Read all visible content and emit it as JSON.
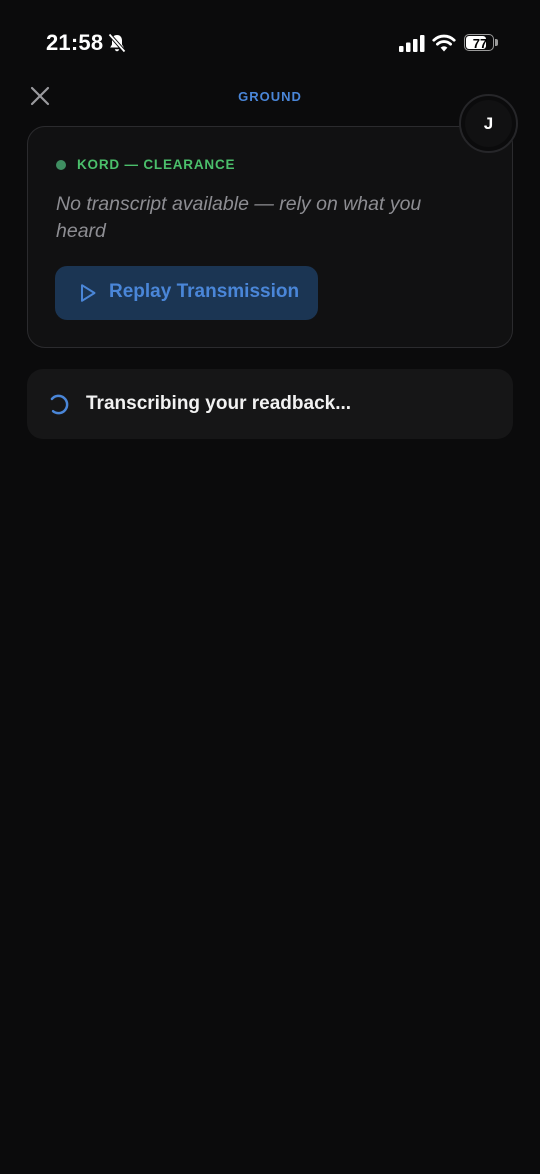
{
  "status_bar": {
    "time": "21:58",
    "battery_level": 77,
    "battery_label": "77"
  },
  "header": {
    "title": "GROUND",
    "avatar_initial": "J"
  },
  "transmission": {
    "frequency_label": "KORD — CLEARANCE",
    "transcript_placeholder": "No transcript available — rely on what you heard",
    "replay_label": "Replay Transmission"
  },
  "status": {
    "message": "Transcribing your readback..."
  },
  "colors": {
    "accent": "#4a86d8",
    "freq_green": "#4bbf6b",
    "background": "#0b0b0c"
  },
  "icons": {
    "close": "close-icon",
    "bell": "bell-slash-icon",
    "signal": "cellular-signal-icon",
    "wifi": "wifi-icon",
    "play": "play-icon",
    "spinner": "spinner-icon"
  }
}
